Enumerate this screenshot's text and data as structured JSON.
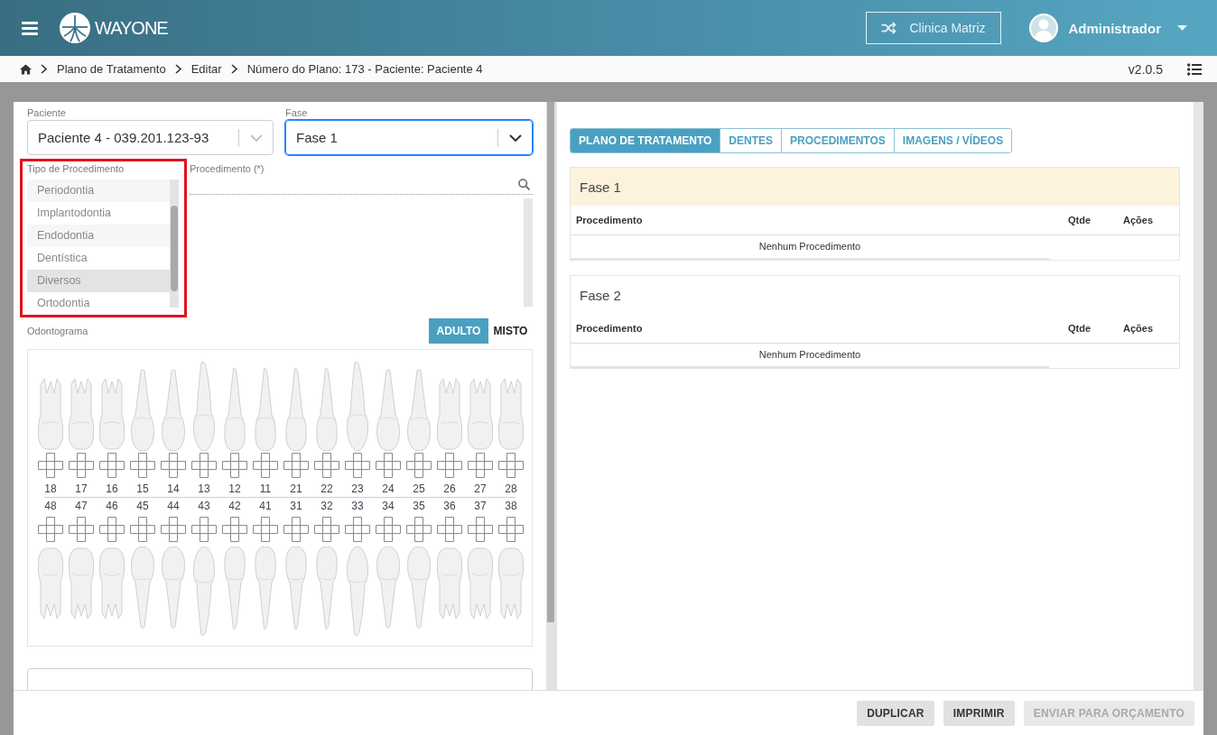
{
  "header": {
    "logo": "**WAY**ONE",
    "clinic_button": "Clinica Matriz",
    "user_name": "Administrador"
  },
  "breadcrumb": {
    "items": [
      "Plano de Tratamento",
      "Editar",
      "Número do Plano: 173 - Paciente: Paciente 4"
    ],
    "version": "v2.0.5"
  },
  "form": {
    "patient": {
      "label": "Paciente",
      "value": "Paciente 4 - 039.201.123-93",
      "focused": false
    },
    "phase": {
      "label": "Fase",
      "value": "Fase 1",
      "focused": true
    },
    "procedure_type": {
      "label": "Tipo de Procedimento",
      "highlighted": true,
      "options": [
        {
          "label": "Periodontia",
          "hovered": false
        },
        {
          "label": "Implantodontia",
          "hovered": false
        },
        {
          "label": "Endodontia",
          "hovered": false
        },
        {
          "label": "Dentística",
          "hovered": false
        },
        {
          "label": "Diversos",
          "hovered": true
        },
        {
          "label": "Ortodontia",
          "hovered": false
        }
      ]
    },
    "procedure": {
      "label": "Procedimento (*)"
    }
  },
  "odontogram": {
    "label": "Odontograma",
    "modes": [
      {
        "label": "ADULTO",
        "selected": true
      },
      {
        "label": "MISTO",
        "selected": false
      }
    ],
    "upper": [
      {
        "number": "18",
        "kind": "molar"
      },
      {
        "number": "17",
        "kind": "molar"
      },
      {
        "number": "16",
        "kind": "molar"
      },
      {
        "number": "15",
        "kind": "premolar"
      },
      {
        "number": "14",
        "kind": "premolar"
      },
      {
        "number": "13",
        "kind": "canine"
      },
      {
        "number": "12",
        "kind": "incisor"
      },
      {
        "number": "11",
        "kind": "incisor"
      },
      {
        "number": "21",
        "kind": "incisor"
      },
      {
        "number": "22",
        "kind": "incisor"
      },
      {
        "number": "23",
        "kind": "canine"
      },
      {
        "number": "24",
        "kind": "premolar"
      },
      {
        "number": "25",
        "kind": "premolar"
      },
      {
        "number": "26",
        "kind": "molar"
      },
      {
        "number": "27",
        "kind": "molar"
      },
      {
        "number": "28",
        "kind": "molar"
      }
    ],
    "lower": [
      {
        "number": "48",
        "kind": "molar"
      },
      {
        "number": "47",
        "kind": "molar"
      },
      {
        "number": "46",
        "kind": "molar"
      },
      {
        "number": "45",
        "kind": "premolar"
      },
      {
        "number": "44",
        "kind": "premolar"
      },
      {
        "number": "43",
        "kind": "canine"
      },
      {
        "number": "42",
        "kind": "incisor"
      },
      {
        "number": "41",
        "kind": "incisor"
      },
      {
        "number": "31",
        "kind": "incisor"
      },
      {
        "number": "32",
        "kind": "incisor"
      },
      {
        "number": "33",
        "kind": "canine"
      },
      {
        "number": "34",
        "kind": "premolar"
      },
      {
        "number": "35",
        "kind": "premolar"
      },
      {
        "number": "36",
        "kind": "molar"
      },
      {
        "number": "37",
        "kind": "molar"
      },
      {
        "number": "38",
        "kind": "molar"
      }
    ]
  },
  "plan": {
    "tabs": [
      {
        "label": "PLANO DE TRATAMENTO",
        "selected": true
      },
      {
        "label": "DENTES",
        "selected": false
      },
      {
        "label": "PROCEDIMENTOS",
        "selected": false
      },
      {
        "label": "IMAGENS / VÍDEOS",
        "selected": false
      }
    ],
    "phases": [
      {
        "title": "Fase 1",
        "selected": true,
        "columns": [
          "Procedimento",
          "Qtde",
          "Ações"
        ],
        "empty_text": "Nenhum Procedimento"
      },
      {
        "title": "Fase 2",
        "selected": false,
        "columns": [
          "Procedimento",
          "Qtde",
          "Ações"
        ],
        "empty_text": "Nenhum Procedimento"
      }
    ]
  },
  "footer": {
    "buttons": [
      {
        "label": "DUPLICAR",
        "disabled": false
      },
      {
        "label": "IMPRIMIR",
        "disabled": false
      },
      {
        "label": "ENVIAR PARA ORÇAMENTO",
        "disabled": true
      }
    ]
  }
}
